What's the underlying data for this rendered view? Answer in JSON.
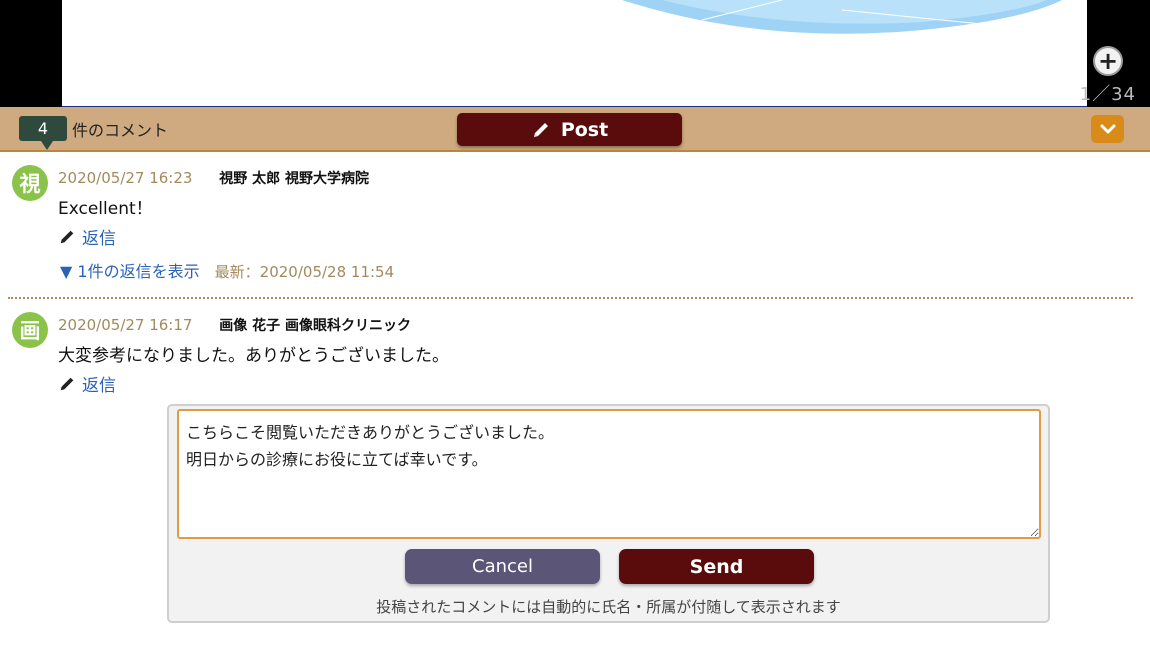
{
  "viewer": {
    "page_counter": "1／34",
    "zoom_icon": "zoom-plus-icon"
  },
  "comments_bar": {
    "count": "4",
    "count_label": "件のコメント",
    "post_label": "Post",
    "post_icon": "pencil-icon",
    "collapse_icon": "chevron-down-icon"
  },
  "comments": [
    {
      "avatar": "視",
      "timestamp": "2020/05/27 16:23",
      "author": "視野 太郎  視野大学病院",
      "body": "Excellent！",
      "reply_label": "返信",
      "thread_toggle": "▼ 1件の返信を表示",
      "latest": "最新：2020/05/28 11:54"
    },
    {
      "avatar": "画",
      "timestamp": "2020/05/27 16:17",
      "author": "画像 花子 画像眼科クリニック",
      "body": "大変参考になりました。ありがとうございました。",
      "reply_label": "返信"
    }
  ],
  "reply_form": {
    "text": "こちらこそ閲覧いただきありがとうございました。\n明日からの診療にお役に立てば幸いです。",
    "cancel_label": "Cancel",
    "send_label": "Send",
    "note": "投稿されたコメントには自動的に氏名・所属が付随して表示されます"
  },
  "colors": {
    "bar_background": "#cfaa80",
    "post_button": "#5a0b0b",
    "cancel_button": "#5b5577",
    "avatar": "#8bc34a",
    "link": "#2a62b5",
    "timestamp": "#a38a5e",
    "textarea_border": "#e39a44",
    "collapse_button": "#d88b19"
  }
}
